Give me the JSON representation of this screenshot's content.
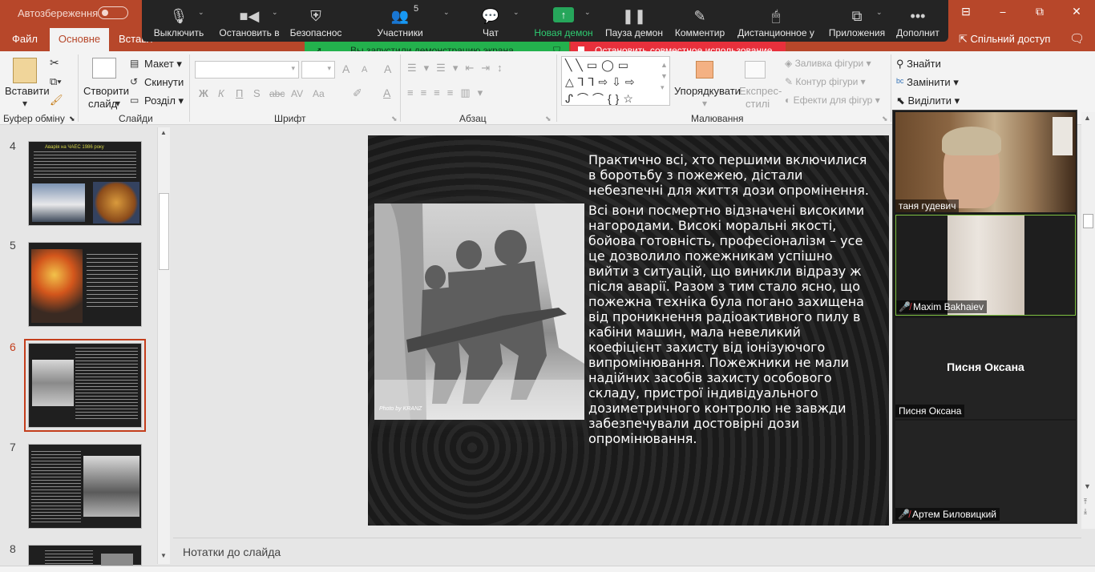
{
  "titlebar": {
    "autosave_label": "Автозбереження",
    "window_minimize": "⎯",
    "window_maximize": "⧉",
    "window_close": "✕",
    "ribbon_display": "⊟"
  },
  "tabs": {
    "file": "Файл",
    "home": "Основне",
    "insert": "Вставл",
    "share": "Спільний доступ"
  },
  "zoom_toolbar": {
    "items": [
      {
        "label": "Выключить",
        "icon": "microphone-icon"
      },
      {
        "label": "Остановить в",
        "icon": "video-camera-icon"
      },
      {
        "label": "Безопаснос",
        "icon": "shield-icon"
      },
      {
        "label": "Участники",
        "icon": "participants-icon",
        "count": "5"
      },
      {
        "label": "Чат",
        "icon": "chat-icon"
      },
      {
        "label": "Новая демон",
        "icon": "share-screen-icon"
      },
      {
        "label": "Пауза демон",
        "icon": "pause-icon"
      },
      {
        "label": "Комментир",
        "icon": "pencil-icon"
      },
      {
        "label": "Дистанционное у",
        "icon": "mouse-icon"
      },
      {
        "label": "Приложения",
        "icon": "apps-icon"
      },
      {
        "label": "Дополнит",
        "icon": "more-icon"
      }
    ],
    "share_arrow": "↑",
    "accent": "#26a65b"
  },
  "share_notice": {
    "sharing_text": "Вы запустили демонстрацию экрана",
    "stop_text": "Остановить совместное использование"
  },
  "ribbon": {
    "clipboard": {
      "paste": "Вставити",
      "group": "Буфер обміну"
    },
    "slides": {
      "new_slide_line1": "Створити",
      "new_slide_line2": "слайд",
      "layout": "Макет",
      "reset": "Скинути",
      "section": "Розділ",
      "group": "Слайди"
    },
    "font": {
      "bold": "Ж",
      "italic": "К",
      "underline": "П",
      "strike": "abc",
      "spacing": "AV",
      "case": "Aa",
      "grow": "A",
      "shrink": "A",
      "clear": "A",
      "group": "Шрифт"
    },
    "paragraph": {
      "group": "Абзац"
    },
    "drawing": {
      "arrange": "Упорядкувати",
      "quick_styles_line1": "Експрес-",
      "quick_styles_line2": "стилі",
      "fill": "Заливка фігури",
      "outline": "Контур фігури",
      "effects": "Ефекти для фігур",
      "group": "Малювання"
    },
    "editing": {
      "find": "Знайти",
      "replace": "Замінити",
      "select": "Виділити"
    }
  },
  "thumbnails": {
    "numbers": [
      "4",
      "5",
      "6",
      "7",
      "8"
    ],
    "selected": "6",
    "slide4_title": "Аварія на ЧАЕС 1986 року"
  },
  "slide": {
    "photo_caption": "Photo by KRANZ",
    "paragraph1": "Практично всі, хто першими включилися в боротьбу з пожежею, дістали небезпечні для життя дози опромінення.",
    "paragraph2": "Всі вони посмертно відзначені високими нагородами. Високі моральні якості, бойова готовність, професіоналізм – усе це дозволило пожежникам успішно вийти з ситуацій, що виникли відразу ж після аварії. Разом з тим стало ясно, що пожежна техніка була погано захищена від проникнення радіоактивного пилу в кабіни машин, мала невеликий коефіцієнт захисту від іонізуючого випромінювання. Пожежники не мали надійних засобів захисту особового складу, пристрої індивідуального дозиметричного контролю не завжди забезпечували достовірні дози опромінювання."
  },
  "notes_placeholder": "Нотатки до слайда",
  "participants": [
    {
      "name": "таня гудевич",
      "muted": false
    },
    {
      "name": "Maxim Bakhaiev",
      "muted": true
    },
    {
      "name": "Писня Оксана",
      "center_name": "Писня Оксана",
      "muted": false
    },
    {
      "name": "Артем Биловицкий",
      "muted": true
    }
  ]
}
